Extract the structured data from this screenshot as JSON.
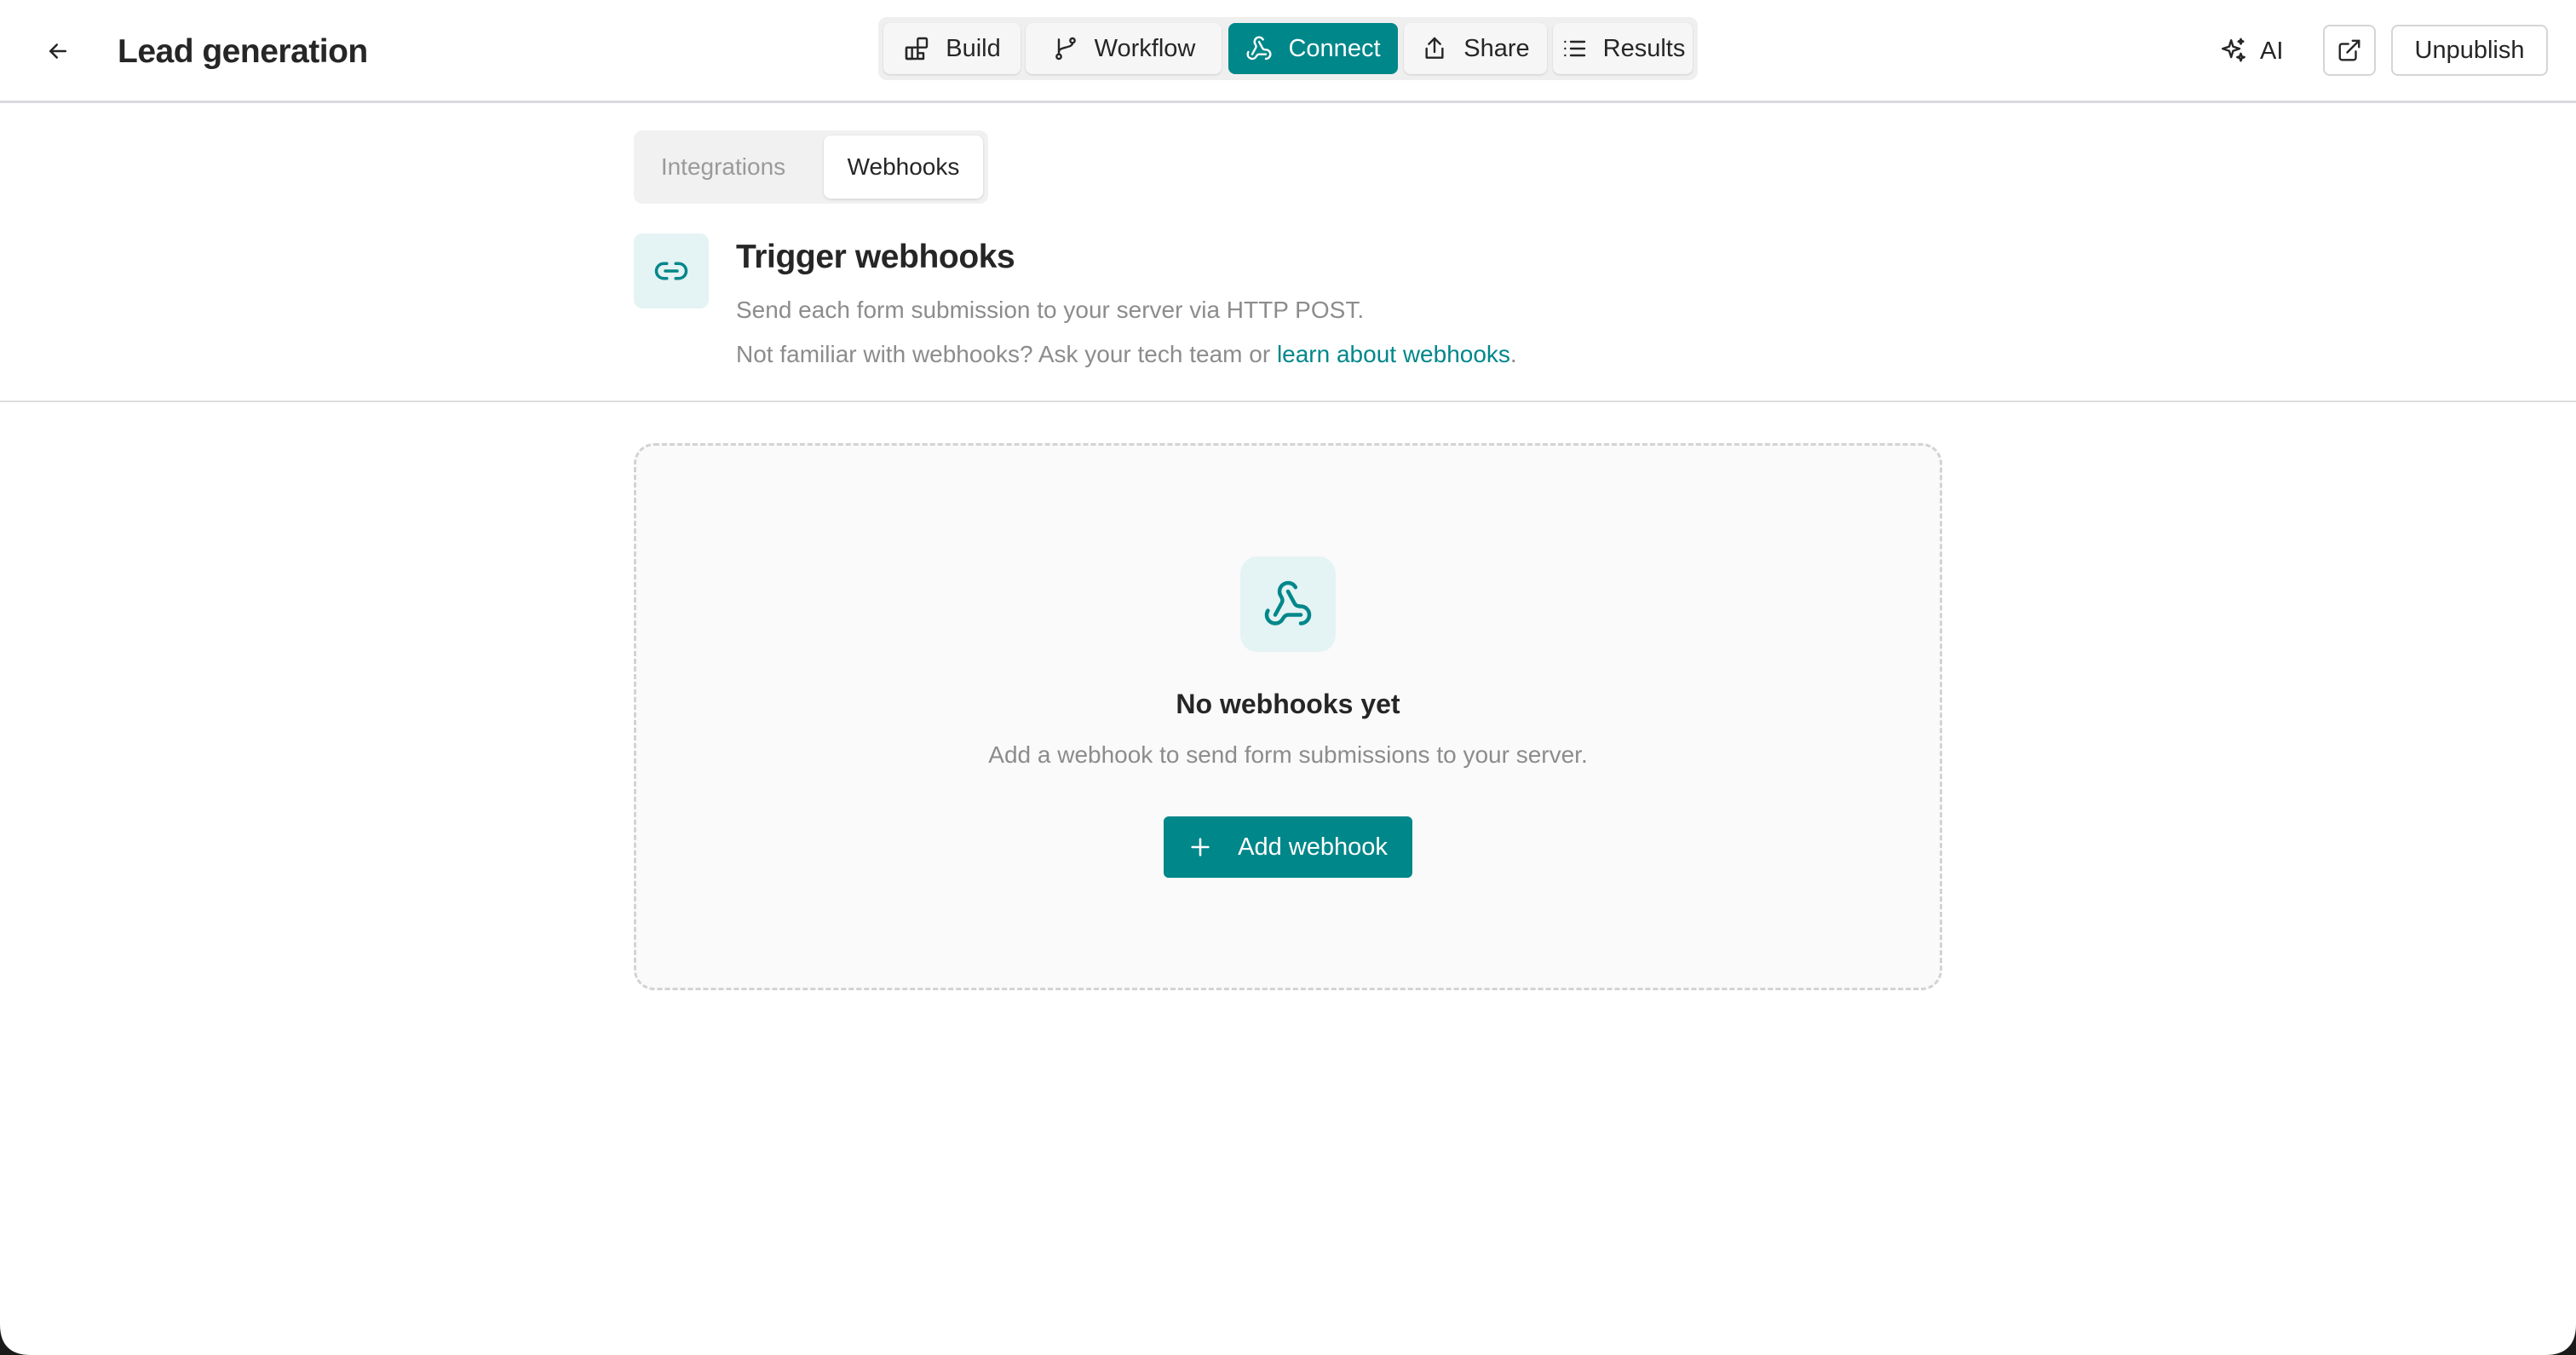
{
  "header": {
    "title": "Lead generation",
    "nav_tabs": [
      {
        "label": "Build",
        "icon": "build-icon",
        "active": false
      },
      {
        "label": "Workflow",
        "icon": "workflow-icon",
        "active": false
      },
      {
        "label": "Connect",
        "icon": "webhook-icon",
        "active": true
      },
      {
        "label": "Share",
        "icon": "share-icon",
        "active": false
      },
      {
        "label": "Results",
        "icon": "list-icon",
        "active": false
      }
    ],
    "ai_label": "AI",
    "unpublish_label": "Unpublish"
  },
  "subtabs": [
    {
      "label": "Integrations",
      "active": false
    },
    {
      "label": "Webhooks",
      "active": true
    }
  ],
  "section": {
    "title": "Trigger webhooks",
    "description": "Send each form submission to your server via HTTP POST.",
    "help_prefix": "Not familiar with webhooks? Ask your tech team or ",
    "help_link": "learn about webhooks",
    "help_suffix": "."
  },
  "empty_state": {
    "title": "No webhooks yet",
    "description": "Add a webhook to send form submissions to your server.",
    "button_label": "Add webhook"
  },
  "colors": {
    "accent": "#00878a",
    "accent_light": "#e4f3f3"
  }
}
